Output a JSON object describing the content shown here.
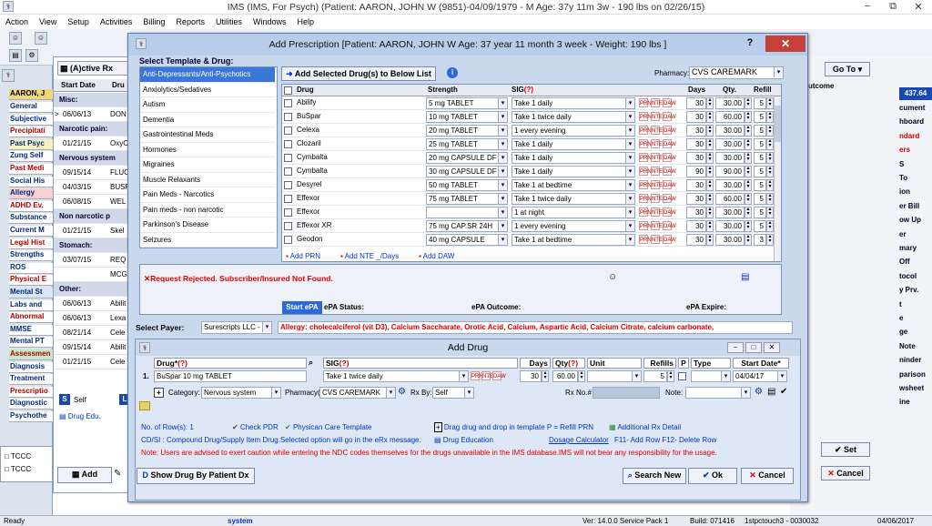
{
  "window": {
    "title": "IMS (IMS, For Psych)   (Patient: AARON, JOHN W (9851)-04/09/1979 - M Age: 37y 11m 3w - 190 lbs on 02/26/15)",
    "minimize": "−",
    "restore": "⧉",
    "close": "✕"
  },
  "menu": [
    "Action",
    "View",
    "Setup",
    "Activities",
    "Billing",
    "Reports",
    "Utilities",
    "Windows",
    "Help"
  ],
  "left_nav": {
    "patient": "AARON, J",
    "items": [
      "General",
      "Subjective",
      "Precipitati",
      "Past Psyc",
      "Zung Self",
      "Past Medi",
      "Social His",
      "Allergy",
      "ADHD Ev.",
      "Substance",
      "Current M",
      "Legal Hist",
      "Strengths",
      "ROS",
      "Physical E",
      "Mental St",
      "Labs and",
      "Abnormal",
      "MMSE",
      "Mental PT",
      "Assessmen",
      "Diagnosis",
      "Treatment",
      "Prescriptio",
      "Diagnostic",
      "Psychothe"
    ]
  },
  "rx_list": {
    "tab": "(A)ctive Rx",
    "headers": [
      "Start Date",
      "Dru"
    ],
    "rows": [
      {
        "h": "Misc:"
      },
      {
        "d": "06/06/13",
        "n": "DON",
        "arrow": ">"
      },
      {
        "h": "Narcotic pain:"
      },
      {
        "d": "01/21/15",
        "n": "OxyC"
      },
      {
        "h": "Nervous system"
      },
      {
        "d": "09/15/14",
        "n": "FLUC"
      },
      {
        "d": "04/03/15",
        "n": "BUSP"
      },
      {
        "d": "06/08/15",
        "n": "WEL"
      },
      {
        "h": "Non narcotic p"
      },
      {
        "d": "01/21/15",
        "n": "Skel"
      },
      {
        "h": "Stomach:"
      },
      {
        "d": "03/07/15",
        "n": "REQ"
      },
      {
        "d": "",
        "n": "MCG"
      },
      {
        "h": "Other:"
      },
      {
        "d": "06/06/13",
        "n": "Abilit"
      },
      {
        "d": "06/06/13",
        "n": "Lexa"
      },
      {
        "d": "08/21/14",
        "n": "Cele"
      },
      {
        "d": "09/15/14",
        "n": "Abilit"
      },
      {
        "d": "01/21/15",
        "n": "Cele"
      }
    ],
    "self": "Self",
    "drug_edu": "Drug Edu.",
    "tccc": [
      "TCCC",
      "TCCC"
    ],
    "add": "Add"
  },
  "right_panel": {
    "goto": "Go To",
    "outcome": "utcome",
    "amount": "437.64",
    "items": [
      "cument",
      "hboard",
      "ndard",
      "ers",
      "S",
      "To",
      "ion",
      "er Bill",
      "ow Up",
      "er",
      "mary",
      "Off",
      "tocol",
      "y Prv.",
      "t",
      "e",
      "ge",
      "Note",
      "ninder",
      "parison",
      "wsheet",
      "ine"
    ],
    "set": "Set",
    "cancel": "Cancel"
  },
  "dialog": {
    "title": "Add Prescription  [Patient: AARON, JOHN W  Age: 37 year 11 month 3 week - Weight: 190 lbs ]",
    "help": "?",
    "close": "✕",
    "select_label": "Select Template & Drug:",
    "categories": [
      "Anti-Depressants/Anti-Psychotics",
      "Anxiolytics/Sedatives",
      "Autism",
      "Dementia",
      "Gastrointestinal Meds",
      "Hormones",
      "Migraines",
      "Muscle Relaxants",
      "Pain Meds - Narcotics",
      "Pain meds - non narcotic",
      "Parkinson's Disease",
      "Seizures"
    ],
    "add_selected": "Add Selected Drug(s) to Below List",
    "pharmacy_label": "Pharmacy:",
    "pharmacy": "CVS CAREMARK",
    "grid_headers": {
      "drug": "Drug",
      "strength": "Strength",
      "sig": "SIG",
      "sig_q": "(?)",
      "days": "Days",
      "qty": "Qty.",
      "refill": "Refill"
    },
    "drugs": [
      {
        "drug": "Abilify",
        "strength": "5 mg TABLET",
        "sig": "Take 1 daily",
        "days": "30",
        "qty": "30.00",
        "refill": "5"
      },
      {
        "drug": "BuSpar",
        "strength": "10 mg TABLET",
        "sig": "Take 1 twice daily",
        "days": "30",
        "qty": "60.00",
        "refill": "5"
      },
      {
        "drug": "Celexa",
        "strength": "20 mg TABLET",
        "sig": "1 every evening",
        "days": "30",
        "qty": "30.00",
        "refill": "5"
      },
      {
        "drug": "Clozaril",
        "strength": "25 mg TABLET",
        "sig": "Take 1 daily",
        "days": "30",
        "qty": "30.00",
        "refill": "5"
      },
      {
        "drug": "Cymbalta",
        "strength": "20 mg CAPSULE DF",
        "sig": "Take 1 daily",
        "days": "30",
        "qty": "30.00",
        "refill": "5"
      },
      {
        "drug": "Cymbalta",
        "strength": "30 mg CAPSULE DF",
        "sig": "Take 1 daily",
        "days": "90",
        "qty": "90.00",
        "refill": "5"
      },
      {
        "drug": "Desyrel",
        "strength": "50 mg TABLET",
        "sig": "Take 1 at bedtime",
        "days": "30",
        "qty": "30.00",
        "refill": "5"
      },
      {
        "drug": "Effexor",
        "strength": "75 mg TABLET",
        "sig": "Take 1 twice daily",
        "days": "30",
        "qty": "60.00",
        "refill": "5"
      },
      {
        "drug": "Effexor",
        "strength": "",
        "sig": "1 at night",
        "days": "30",
        "qty": "30.00",
        "refill": "5"
      },
      {
        "drug": "Effexor XR",
        "strength": "75 mg CAP.SR 24H",
        "sig": "1 every evening",
        "days": "30",
        "qty": "30.00",
        "refill": "5"
      },
      {
        "drug": "Geodon",
        "strength": "40 mg CAPSULE",
        "sig": "Take 1 at bedtime",
        "days": "30",
        "qty": "30.00",
        "refill": "3"
      }
    ],
    "add_prn": "Add PRN",
    "add_nte": "Add NTE _/Days",
    "add_daw": "Add DAW",
    "rejected": "Request Rejected. Subscriber/Insured Not Found.",
    "start_epa": "Start ePA",
    "epa_status": "ePA Status:",
    "epa_outcome": "ePA Outcome:",
    "epa_expire": "ePA Expire:",
    "payer_label": "Select Payer:",
    "payer": "Surescripts LLC -",
    "allergy": "Allergy: cholecalciferol (vit D3), Calcium Saccharate, Orotic Acid, Calcium, Aspartic Acid, Calcium Citrate, calcium carbonate,",
    "add_drug": {
      "title": "Add Drug",
      "headers": {
        "drug": "Drug*",
        "drug_q": "(?)",
        "sig": "SIG",
        "sig_q": "(?)",
        "days": "Days",
        "qty": "Qty",
        "qty_q": "(?)",
        "unit": "Unit",
        "refills": "Refills",
        "p": "P",
        "type": "Type",
        "start": "Start Date*"
      },
      "row": {
        "n": "1.",
        "drug": "BuSpar 10 mg TABLET",
        "sig": "Take 1 twice daily",
        "days": "30",
        "qty": "60.00",
        "refills": "5",
        "start": "04/04/17"
      },
      "category_label": "Category:",
      "category": "Nervous system",
      "pharmacy_label": "Pharmacy(?)",
      "pharmacy": "CVS CAREMARK",
      "rxby_label": "Rx By:",
      "rxby": "Self",
      "rxno_label": "Rx No.#",
      "note_label": "Note:"
    },
    "info": {
      "rows": "No. of Row(s): 1",
      "check_pdr": "Check PDR",
      "care_template": "Physican Care Template",
      "drag": "Drag drug and drop in template  P = Refill PRN",
      "addl": "Additional Rx Detail",
      "cdsi": "CD/SI : Compound Drug/Supply Item Drug.Selected option will go in the eRx message.",
      "drug_education": "Drug Education",
      "dosage_calc": "Dosage Calculator",
      "keys": "F11- Add Row  F12- Delete Row",
      "note": "Note: Users are advised to exert caution while entering the NDC codes themselves for the drugs unavailable in the IMS database.IMS will not bear any responsibility for the usage."
    },
    "buttons": {
      "show_drug": "Show Drug By Patient Dx",
      "search_new": "Search New",
      "ok": "Ok",
      "cancel": "Cancel"
    }
  },
  "status": {
    "ready": "Ready",
    "user": "system",
    "ver": "Ver: 14.0.0 Service Pack 1",
    "build": "Build: 071416",
    "station": "1stpctouch3 - 0030032",
    "date": "04/06/2017"
  },
  "colors": {
    "accent": "#3a78d8",
    "error": "#dd0000",
    "dialog_bg": "#c9d8ec",
    "subtitle": "#0033cc"
  }
}
